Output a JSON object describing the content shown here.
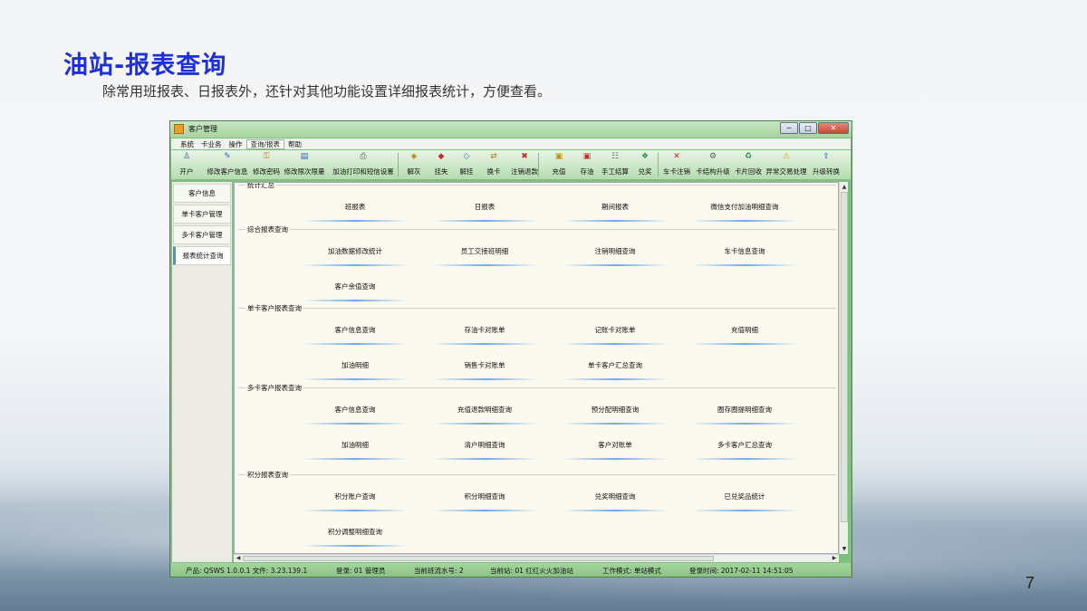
{
  "slide": {
    "title": "油站-报表查询",
    "subtitle": "除常用班报表、日报表外，还针对其他功能设置详细报表统计，方便查看。",
    "page_number": "7"
  },
  "window": {
    "title": "客户管理",
    "controls": {
      "minimize": "─",
      "maximize": "□",
      "close": "✕"
    }
  },
  "menubar": {
    "items": [
      "系统",
      "卡业务",
      "操作",
      "查询/报表",
      "帮助"
    ],
    "active_index": 3
  },
  "toolbar": {
    "buttons": [
      {
        "label": "开户",
        "icon": "user-add-icon",
        "glyph": "♙",
        "color": "#3a60b0"
      },
      {
        "label": "修改客户信息",
        "icon": "user-edit-icon",
        "glyph": "✎",
        "color": "#3a60b0"
      },
      {
        "label": "修改密码",
        "icon": "key-icon",
        "glyph": "⚿",
        "color": "#c07a10"
      },
      {
        "label": "修改限次限量",
        "icon": "limit-icon",
        "glyph": "▤",
        "color": "#2a5fc0"
      },
      {
        "label": "加油打印和短信设置",
        "icon": "printer-icon",
        "glyph": "⎙",
        "color": "#555"
      },
      {
        "label": "解灰",
        "icon": "unlock-gray-icon",
        "glyph": "◈",
        "color": "#b07a10"
      },
      {
        "label": "挂失",
        "icon": "report-loss-icon",
        "glyph": "◆",
        "color": "#c0302a"
      },
      {
        "label": "解挂",
        "icon": "unhang-icon",
        "glyph": "◇",
        "color": "#2a6ab0"
      },
      {
        "label": "换卡",
        "icon": "swap-card-icon",
        "glyph": "⇄",
        "color": "#b07a10"
      },
      {
        "label": "注销退款",
        "icon": "cancel-refund-icon",
        "glyph": "✖",
        "color": "#c0302a"
      },
      {
        "label": "充值",
        "icon": "recharge-icon",
        "glyph": "▣",
        "color": "#c09010"
      },
      {
        "label": "存油",
        "icon": "store-oil-icon",
        "glyph": "▣",
        "color": "#c0302a"
      },
      {
        "label": "手工结算",
        "icon": "manual-settle-icon",
        "glyph": "☷",
        "color": "#777"
      },
      {
        "label": "兑奖",
        "icon": "redeem-icon",
        "glyph": "❖",
        "color": "#2a8a4a"
      },
      {
        "label": "车卡注销",
        "icon": "car-card-cancel-icon",
        "glyph": "✕",
        "color": "#d02020"
      },
      {
        "label": "卡结构升级",
        "icon": "card-upgrade-icon",
        "glyph": "⚙",
        "color": "#555"
      },
      {
        "label": "卡片回收",
        "icon": "card-recycle-icon",
        "glyph": "♻",
        "color": "#2a8a4a"
      },
      {
        "label": "异常交易处理",
        "icon": "warning-icon",
        "glyph": "⚠",
        "color": "#d0a010"
      },
      {
        "label": "升级转换",
        "icon": "upgrade-convert-icon",
        "glyph": "⇪",
        "color": "#2a5fc0"
      }
    ]
  },
  "sidebar": {
    "items": [
      "客户信息",
      "单卡客户管理",
      "多卡客户管理",
      "报表统计查询"
    ],
    "active_index": 3
  },
  "sections": [
    {
      "title": "统计汇总",
      "items": [
        "班报表",
        "日报表",
        "期间报表",
        "微信支付加油明细查询"
      ]
    },
    {
      "title": "综合报表查询",
      "items": [
        "加油数据修改统计",
        "员工交接班明细",
        "注销明细查询",
        "车卡信息查询",
        "客户余值查询"
      ]
    },
    {
      "title": "单卡客户报表查询",
      "items": [
        "客户信息查询",
        "存油卡对账单",
        "记账卡对账单",
        "充值明细",
        "加油明细",
        "销售卡对账单",
        "单卡客户汇总查询"
      ]
    },
    {
      "title": "多卡客户报表查询",
      "items": [
        "客户信息查询",
        "充值退款明细查询",
        "预分配明细查询",
        "圈存圈提明细查询",
        "加油明细",
        "清户明细查询",
        "客户对账单",
        "多卡客户汇总查询"
      ]
    },
    {
      "title": "积分报表查询",
      "items": [
        "积分账户查询",
        "积分明细查询",
        "兑奖明细查询",
        "已兑奖品统计",
        "积分调整明细查询"
      ]
    }
  ],
  "statusbar": {
    "product": "产品: QSWS 1.0.0.1 文件:  3.23.139.1",
    "login": "登录: 01 管理员",
    "shift": "当前班流水号: 2",
    "station": "当前站: 01 红红火火加油站",
    "mode": "工作模式: 单站模式",
    "login_time": "登录时间: 2017-02-11 14:51:05"
  }
}
